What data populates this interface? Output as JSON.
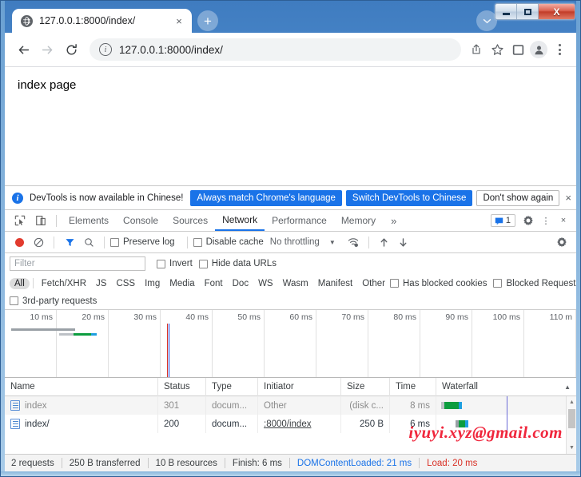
{
  "window": {
    "minimize_label": "Minimize",
    "maximize_label": "Maximize",
    "close_label": "X"
  },
  "tabstrip": {
    "tab_title": "127.0.0.1:8000/index/",
    "tab_close": "×",
    "new_tab": "+",
    "tab_search": "⌄"
  },
  "toolbar": {
    "back": "←",
    "forward": "→",
    "reload": "⟳",
    "info": "i",
    "url": "127.0.0.1:8000/index/",
    "share": "share-icon",
    "bookmark": "☆",
    "sidepanel": "side-panel-icon",
    "profile": "profile-icon",
    "menu": "⋮"
  },
  "page": {
    "body_text": "index page"
  },
  "devtools": {
    "banner": {
      "info": "i",
      "message": "DevTools is now available in Chinese!",
      "primary_button": "Always match Chrome's language",
      "secondary_button": "Switch DevTools to Chinese",
      "tertiary_button": "Don't show again",
      "close": "×"
    },
    "panel_tabs": [
      {
        "label": "Elements",
        "active": false
      },
      {
        "label": "Console",
        "active": false
      },
      {
        "label": "Sources",
        "active": false
      },
      {
        "label": "Network",
        "active": true
      },
      {
        "label": "Performance",
        "active": false
      },
      {
        "label": "Memory",
        "active": false
      }
    ],
    "more_tabs": "»",
    "message_count": "1",
    "settings_icon": "gear-icon",
    "kebab_icon": "⋮",
    "close_icon": "×",
    "network_toolbar": {
      "record": "record-icon",
      "clear": "clear-icon",
      "filter": "filter-icon",
      "search": "search-icon",
      "preserve_log": "Preserve log",
      "disable_cache": "Disable cache",
      "throttling": "No throttling",
      "throttle_caret": "▼",
      "wifi": "network-conditions-icon",
      "import": "import-har-icon",
      "export": "export-har-icon",
      "settings": "gear-icon"
    },
    "filter_bar": {
      "placeholder": "Filter",
      "invert": "Invert",
      "hide_data_urls": "Hide data URLs"
    },
    "type_chips": [
      {
        "label": "All",
        "selected": true
      },
      {
        "label": "Fetch/XHR",
        "selected": false
      },
      {
        "label": "JS",
        "selected": false
      },
      {
        "label": "CSS",
        "selected": false
      },
      {
        "label": "Img",
        "selected": false
      },
      {
        "label": "Media",
        "selected": false
      },
      {
        "label": "Font",
        "selected": false
      },
      {
        "label": "Doc",
        "selected": false
      },
      {
        "label": "WS",
        "selected": false
      },
      {
        "label": "Wasm",
        "selected": false
      },
      {
        "label": "Manifest",
        "selected": false
      },
      {
        "label": "Other",
        "selected": false
      }
    ],
    "has_blocked_cookies": "Has blocked cookies",
    "blocked_requests": "Blocked Requests",
    "third_party_requests": "3rd-party requests",
    "overview": {
      "ticks": [
        "10 ms",
        "20 ms",
        "30 ms",
        "40 ms",
        "50 ms",
        "60 ms",
        "70 ms",
        "80 ms",
        "90 ms",
        "100 ms",
        "110 m"
      ]
    },
    "table": {
      "columns": [
        "Name",
        "Status",
        "Type",
        "Initiator",
        "Size",
        "Time",
        "Waterfall"
      ],
      "sort_indicator": "▲",
      "rows": [
        {
          "name": "index",
          "status": "301",
          "type": "docum...",
          "initiator": "Other",
          "initiator_link": false,
          "size": "(disk c...",
          "time": "8 ms",
          "dim": true
        },
        {
          "name": "index/",
          "status": "200",
          "type": "docum...",
          "initiator": ":8000/index",
          "initiator_link": true,
          "size": "250 B",
          "time": "6 ms",
          "dim": false
        }
      ]
    },
    "statusbar": {
      "requests": "2 requests",
      "transferred": "250 B transferred",
      "resources": "10 B resources",
      "finish": "Finish: 6 ms",
      "dom_content_loaded": "DOMContentLoaded: 21 ms",
      "load": "Load: 20 ms"
    }
  },
  "watermark": "iyuyi.xyz@gmail.com",
  "colors": {
    "accent_blue": "#1a73e8",
    "record_red": "#e23b2e",
    "load_red": "#d93025",
    "waterfall_green": "#0c9d3f",
    "waterfall_blue": "#1e9fe0",
    "title_blue": "#4e8ccd"
  }
}
